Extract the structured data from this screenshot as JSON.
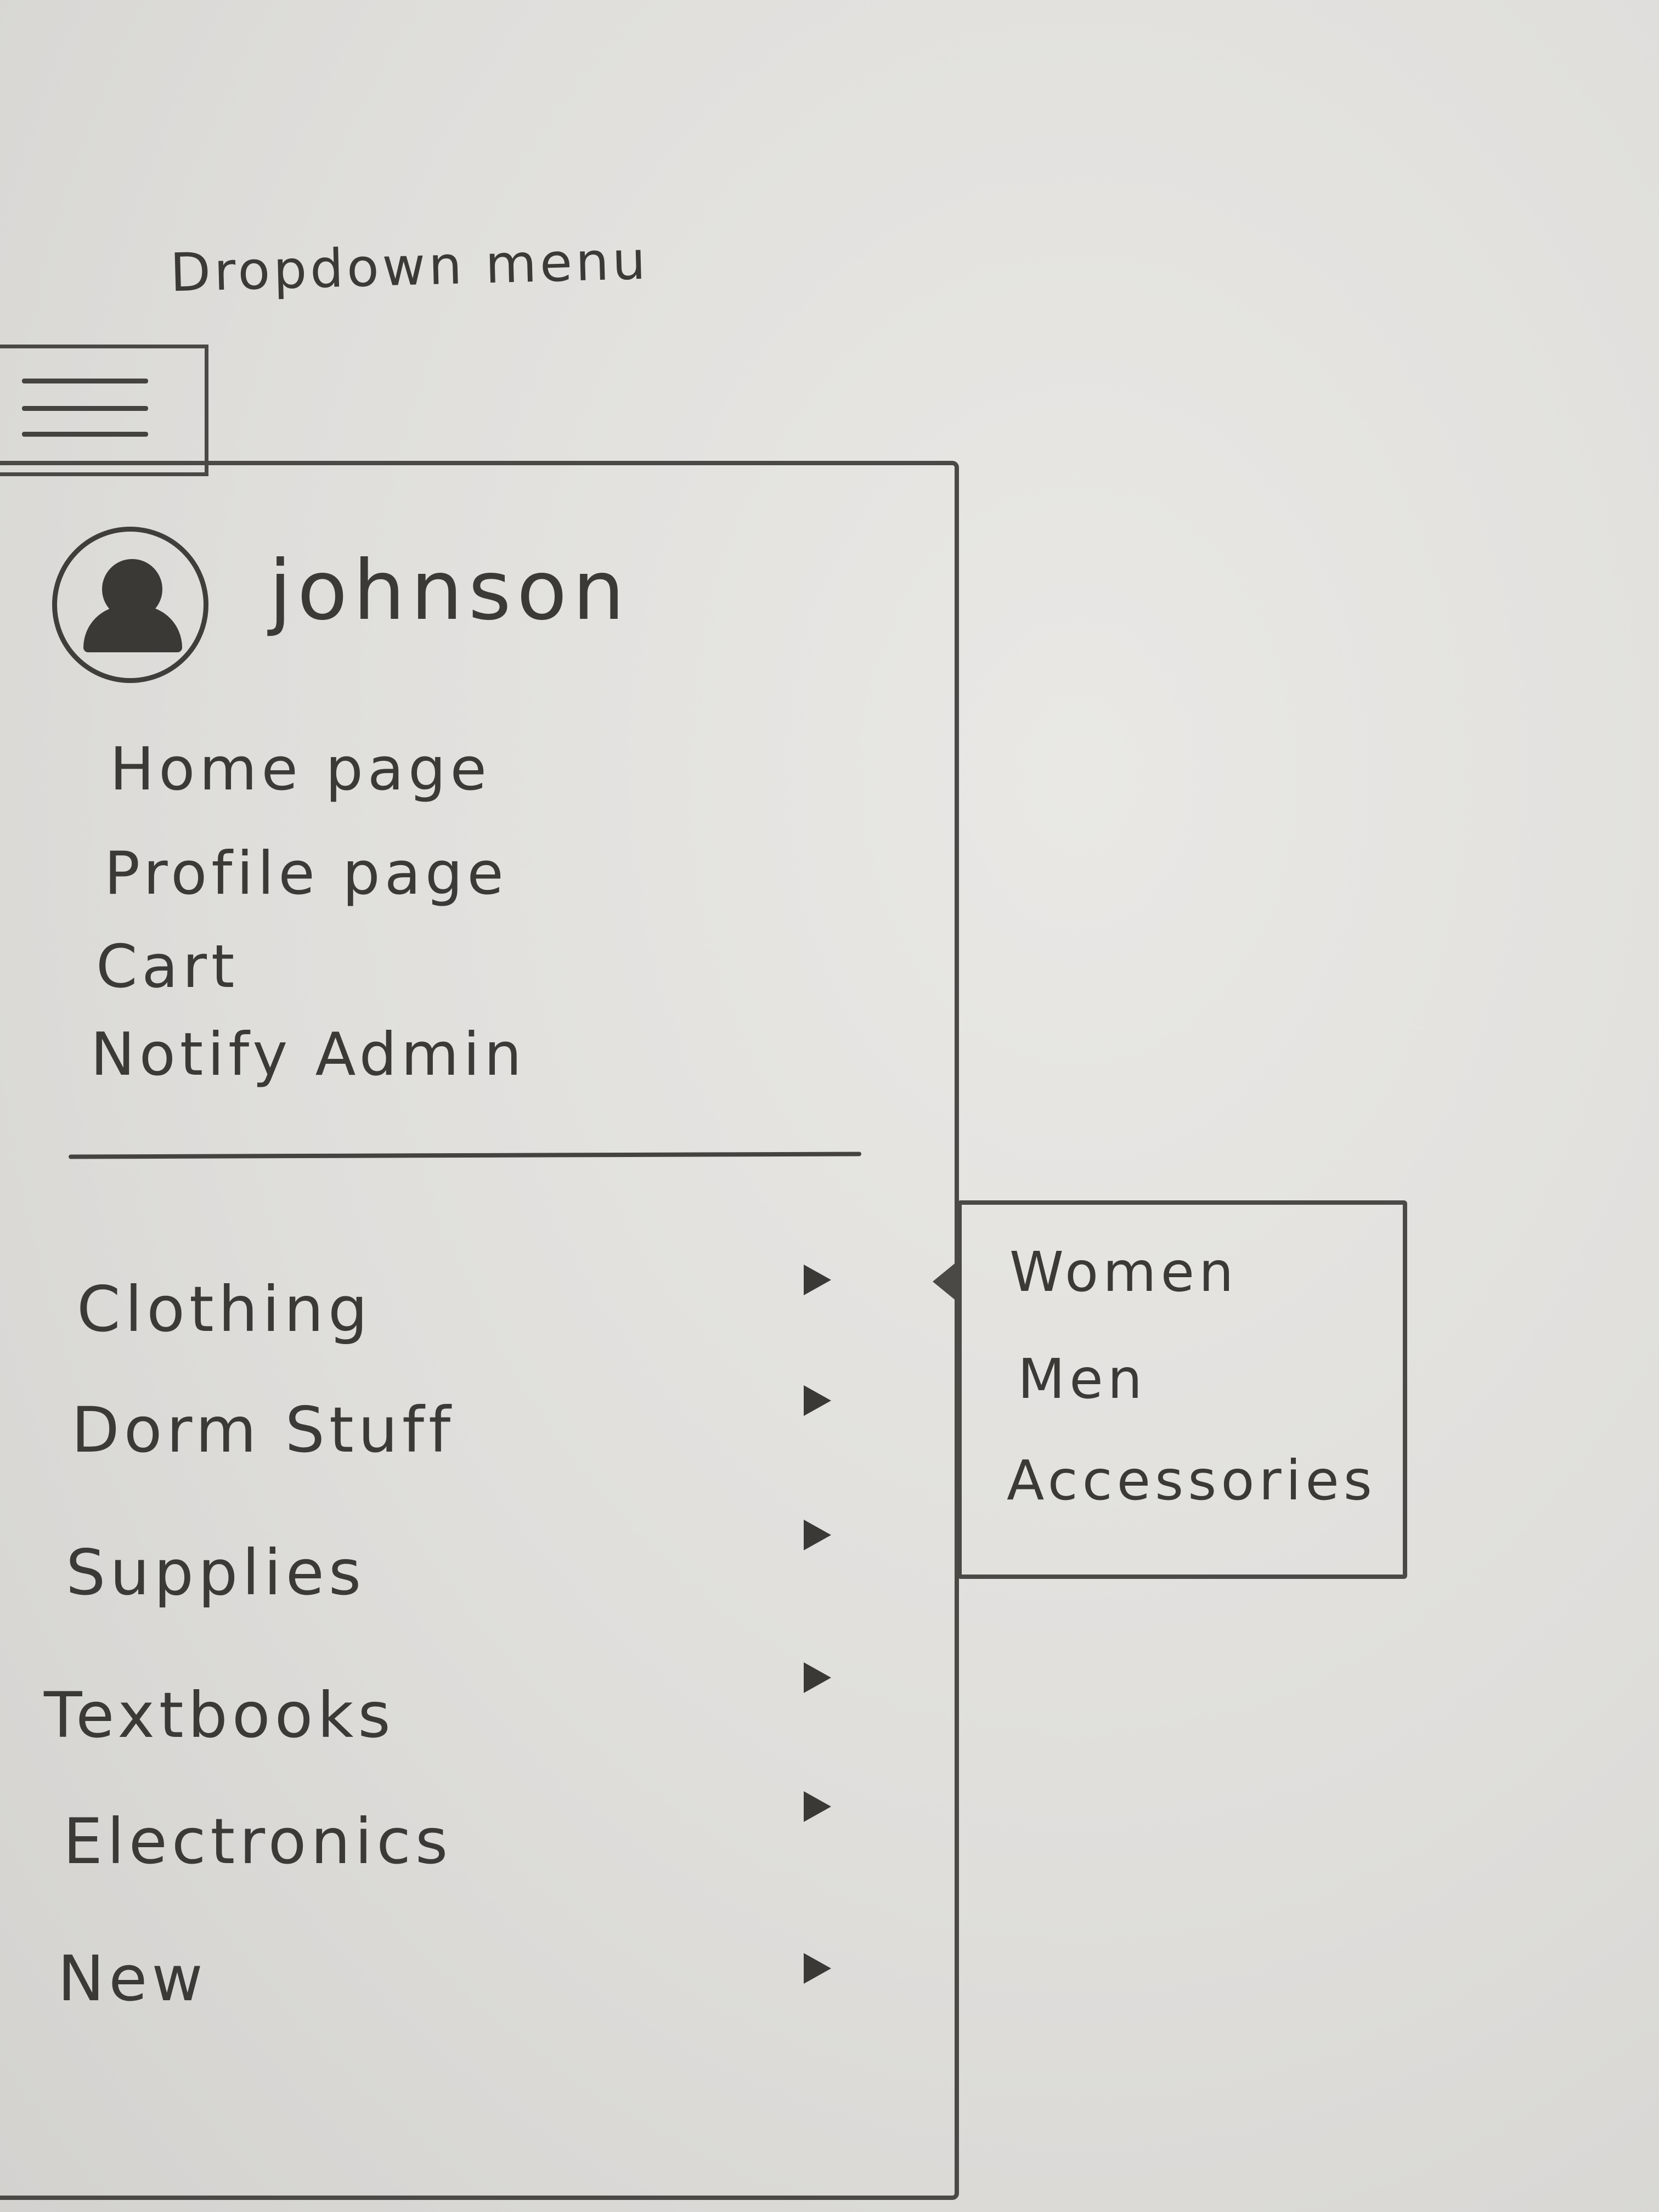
{
  "title": "Dropdown menu",
  "user": {
    "name": "johnson"
  },
  "nav": {
    "items": [
      {
        "label": "Home page"
      },
      {
        "label": "Profile page"
      },
      {
        "label": "Cart"
      },
      {
        "label": "Notify Admin"
      }
    ]
  },
  "categories": [
    {
      "label": "Clothing"
    },
    {
      "label": "Dorm Stuff"
    },
    {
      "label": "Supplies"
    },
    {
      "label": "Textbooks"
    },
    {
      "label": "Electronics"
    },
    {
      "label": "New"
    }
  ],
  "submenu": {
    "items": [
      {
        "label": "Women"
      },
      {
        "label": "Men"
      },
      {
        "label": "Accessories"
      }
    ]
  },
  "icons": {
    "menu": "hamburger-menu-icon",
    "avatar": "user-avatar-icon",
    "submenu_arrow": "triangle-right-icon"
  },
  "colors": {
    "paper": "#e3e2df",
    "ink": "#3b3a37"
  }
}
